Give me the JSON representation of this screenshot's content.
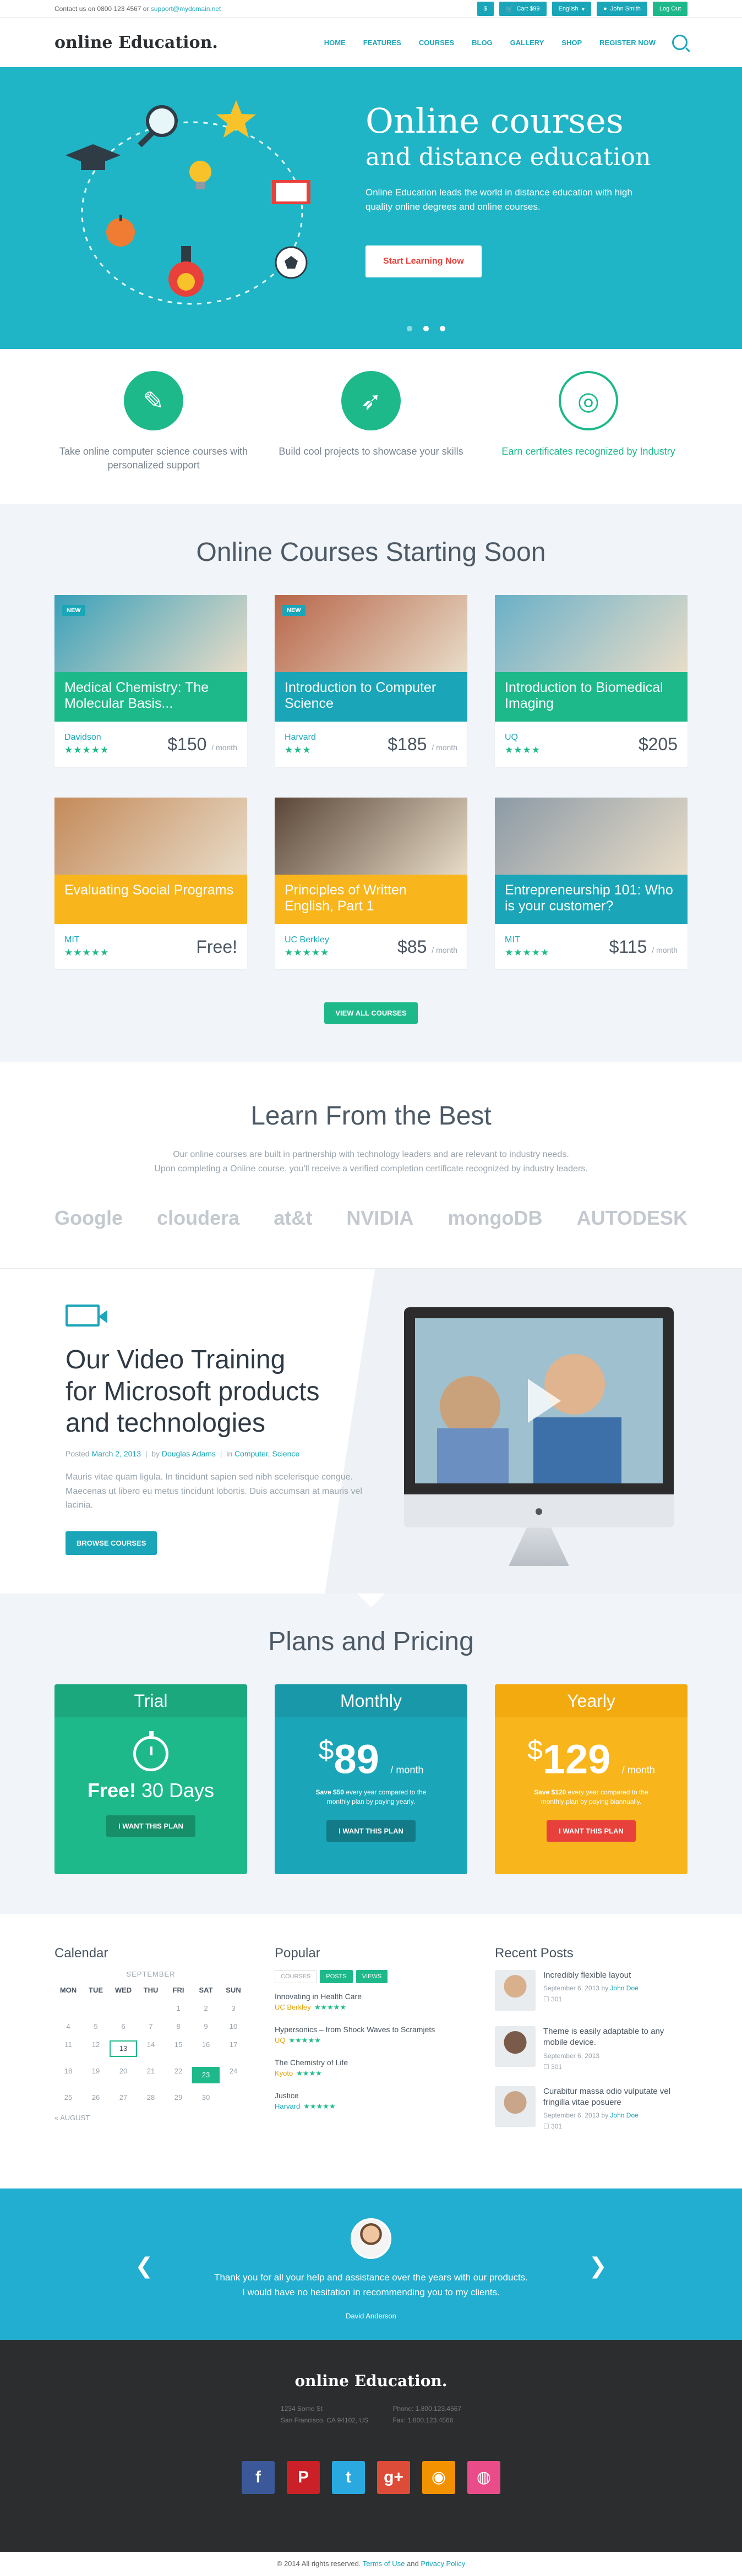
{
  "topbar": {
    "contact_prefix": "Contact us on 0800 123 4567 or",
    "contact_email": "support@mydomain.net",
    "currency": "$",
    "cart": "Cart $99",
    "language": "English",
    "user": "John Smith",
    "logout": "Log Out"
  },
  "header": {
    "logo_a": "online",
    "logo_b": "Education.",
    "nav": [
      "HOME",
      "FEATURES",
      "COURSES",
      "BLOG",
      "GALLERY",
      "SHOP",
      "REGISTER NOW"
    ]
  },
  "hero": {
    "title": "Online courses",
    "subtitle": "and distance education",
    "body": "Online Education leads the world in distance education with high quality online degrees and online courses.",
    "cta": "Start Learning Now"
  },
  "features": [
    {
      "text": "Take online computer science courses with personalized support",
      "icon": "chat-icon"
    },
    {
      "text": "Build cool projects to showcase your skills",
      "icon": "rocket-icon"
    },
    {
      "text": "Earn certificates recognized by Industry",
      "icon": "globe-icon"
    }
  ],
  "courses": {
    "title": "Online Courses Starting Soon",
    "new_badge": "NEW",
    "view_all": "VIEW ALL COURSES",
    "items": [
      {
        "title": "Medical Chemistry: The Molecular Basis...",
        "uni": "Davidson",
        "stars": "★★★★★",
        "price": "$150",
        "per": "/ month",
        "color": "#1eb98a",
        "img": "#3aa0b9",
        "new": true
      },
      {
        "title": "Introduction to Computer Science",
        "uni": "Harvard",
        "stars": "★★★",
        "price": "$185",
        "per": "/ month",
        "color": "#1aa6b8",
        "img": "#b8664a",
        "new": true
      },
      {
        "title": "Introduction to Biomedical Imaging",
        "uni": "UQ",
        "stars": "★★★★",
        "price": "$205",
        "per": "",
        "color": "#1eb98a",
        "img": "#6ab0c8",
        "new": false
      },
      {
        "title": "Evaluating Social Programs",
        "uni": "MIT",
        "stars": "★★★★★",
        "price": "Free!",
        "per": "",
        "color": "#f8b51c",
        "img": "#c48a5a",
        "new": false
      },
      {
        "title": "Principles of Written English, Part 1",
        "uni": "UC Berkley",
        "stars": "★★★★★",
        "price": "$85",
        "per": "/ month",
        "color": "#f8b51c",
        "img": "#5a4638",
        "new": false
      },
      {
        "title": "Entrepreneurship 101: Who is your customer?",
        "uni": "MIT",
        "stars": "★★★★★",
        "price": "$115",
        "per": "/ month",
        "color": "#1aa6b8",
        "img": "#8c9aa6",
        "new": false
      }
    ]
  },
  "partners": {
    "title": "Learn From the Best",
    "body1": "Our online courses are built in partnership with technology leaders and are relevant to industry needs.",
    "body2": "Upon completing a Online course, you'll receive a verified completion certificate recognized by industry leaders.",
    "logos": [
      "Google",
      "cloudera",
      "at&t",
      "NVIDIA",
      "mongoDB",
      "AUTODESK"
    ]
  },
  "video": {
    "title1": "Our Video Training",
    "title2": "for Microsoft products",
    "title3": "and technologies",
    "meta_prefix": "Posted",
    "date": "March 2, 2013",
    "by": "by",
    "author": "Douglas Adams",
    "in": "in",
    "cats": "Computer, Science",
    "body": "Mauris vitae quam ligula. In tincidunt sapien sed nibh scelerisque congue. Maecenas ut libero eu metus tincidunt lobortis. Duis accumsan at mauris vel lacinia.",
    "cta": "BROWSE COURSES"
  },
  "pricing": {
    "title": "Plans and Pricing",
    "plans": [
      {
        "name": "Trial",
        "free": "Free!",
        "days": "30 Days",
        "cta": "I WANT THIS PLAN"
      },
      {
        "name": "Monthly",
        "currency": "$",
        "amount": "89",
        "per": "/ month",
        "note_strong": "Save $50",
        "note": "every year compared to the monthly plan by paying yearly.",
        "cta": "I WANT THIS PLAN"
      },
      {
        "name": "Yearly",
        "currency": "$",
        "amount": "129",
        "per": "/ month",
        "note_strong": "Save $120",
        "note": "every year compared to the monthly plan by paying biannually.",
        "cta": "I WANT THIS PLAN"
      }
    ]
  },
  "widgets": {
    "calendar_title": "Calendar",
    "month": "SEPTEMBER",
    "days": [
      "MON",
      "TUE",
      "WED",
      "THU",
      "FRI",
      "SAT",
      "SUN"
    ],
    "dates": [
      "",
      "",
      "",
      "",
      "1",
      "2",
      "3",
      "4",
      "5",
      "6",
      "7",
      "8",
      "9",
      "10",
      "11",
      "12",
      "13",
      "14",
      "15",
      "16",
      "17",
      "18",
      "19",
      "20",
      "21",
      "22",
      "23",
      "24",
      "25",
      "26",
      "27",
      "28",
      "29",
      "30",
      ""
    ],
    "today": "13",
    "selected": "23",
    "prev": "« AUGUST",
    "popular_title": "Popular",
    "tabs": [
      "COURSES",
      "POSTS",
      "VIEWS"
    ],
    "popular": [
      {
        "title": "Innovating in Health Care",
        "uni": "UC Berkley",
        "stars": "★★★★★",
        "blue": false
      },
      {
        "title": "Hypersonics – from Shock Waves to Scramjets",
        "uni": "UQ",
        "stars": "★★★★★",
        "blue": false
      },
      {
        "title": "The Chemistry of Life",
        "uni": "Kyoto",
        "stars": "★★★★",
        "blue": false
      },
      {
        "title": "Justice",
        "uni": "Harvard",
        "stars": "★★★★★",
        "blue": true
      }
    ],
    "recent_title": "Recent Posts",
    "recent": [
      {
        "title": "Incredibly flexible layout",
        "date": "September 6, 2013 by",
        "author": "John Doe",
        "comments": "☐ 301",
        "thumb": "#d9b08c"
      },
      {
        "title": "Theme is easily adaptable to any mobile device.",
        "date": "September 6, 2013",
        "author": "",
        "comments": "☐ 301",
        "thumb": "#7a5a48"
      },
      {
        "title": "Curabitur massa odio vulputate vel fringilla vitae posuere",
        "date": "September 6, 2013 by",
        "author": "John Doe",
        "comments": "☐ 301",
        "thumb": "#c9a58a"
      }
    ]
  },
  "testimonial": {
    "line1": "Thank you for all your help and assistance over the years with our products.",
    "line2": "I would have no hesitation in recommending you to my clients.",
    "author": "David Anderson"
  },
  "footer": {
    "logo": "online Education.",
    "addr1": "1234 Some St",
    "addr2": "San Francisco, CA 94102, US",
    "phone": "Phone: 1.800.123.4567",
    "fax": "Fax: 1.800.123.4566",
    "social": [
      {
        "label": "f",
        "name": "facebook-icon",
        "color": "#3b5998"
      },
      {
        "label": "P",
        "name": "pinterest-icon",
        "color": "#cb2027"
      },
      {
        "label": "t",
        "name": "twitter-icon",
        "color": "#2aa9e0"
      },
      {
        "label": "g+",
        "name": "googleplus-icon",
        "color": "#dd4b39"
      },
      {
        "label": "◉",
        "name": "rss-icon",
        "color": "#f39200"
      },
      {
        "label": "◍",
        "name": "dribbble-icon",
        "color": "#ea4c89"
      }
    ],
    "copy_a": "© 2014 All rights reserved.",
    "terms": "Terms of Use",
    "and": "and",
    "privacy": "Privacy Policy"
  },
  "colors": {
    "teal": "#1aa6b8",
    "green": "#1eb98a",
    "yellow": "#f8b51c",
    "hero": "#20b5c6"
  }
}
